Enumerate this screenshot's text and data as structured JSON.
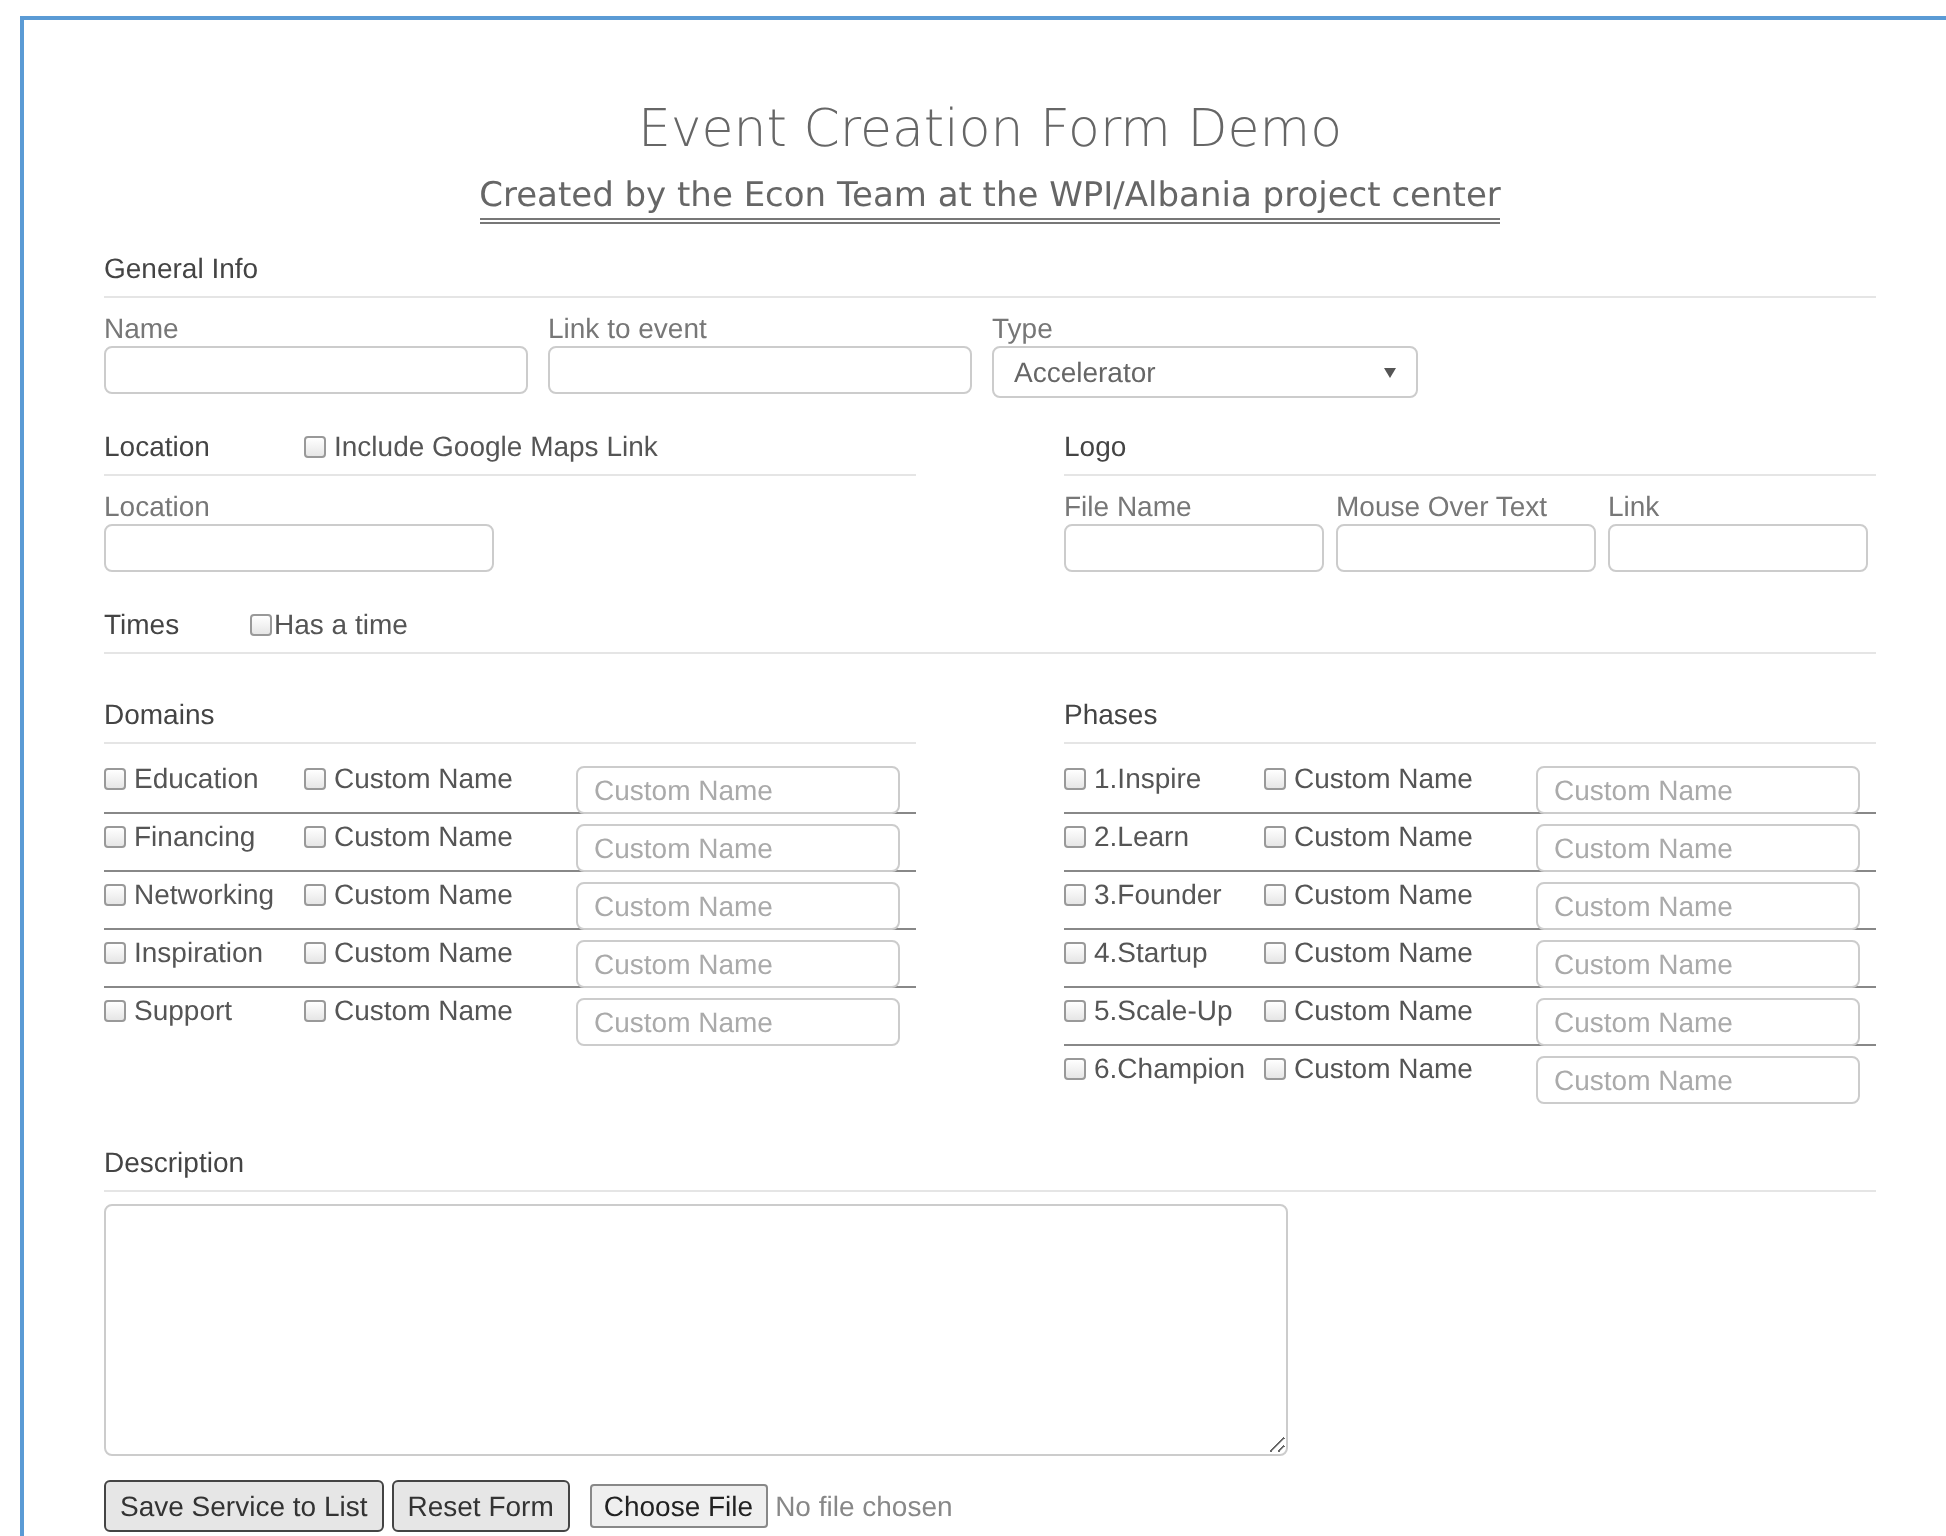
{
  "title": "Event Creation Form Demo",
  "subtitle": "Created by the Econ Team at the WPI/Albania project center",
  "general_info": {
    "heading": "General Info",
    "fields": [
      {
        "label": "Name",
        "kind": "text"
      },
      {
        "label": "Link to event",
        "kind": "text"
      },
      {
        "label": "Type",
        "kind": "select",
        "value": "Accelerator"
      }
    ]
  },
  "location": {
    "heading": "Location",
    "checkbox": {
      "label": "Include Google Maps Link",
      "checked": false
    },
    "field_label": "Location"
  },
  "logo": {
    "heading": "Logo",
    "fields": [
      "File Name",
      "Mouse Over Text",
      "Link"
    ]
  },
  "times": {
    "heading": "Times",
    "checkbox": {
      "label": "Has a time",
      "checked": false
    }
  },
  "domains": {
    "heading": "Domains",
    "rows": [
      {
        "label": "Education",
        "checked": false,
        "custom_label": "Custom Name",
        "custom_checked": false,
        "placeholder": "Custom Name"
      },
      {
        "label": "Financing",
        "checked": false,
        "custom_label": "Custom Name",
        "custom_checked": false,
        "placeholder": "Custom Name"
      },
      {
        "label": "Networking",
        "checked": false,
        "custom_label": "Custom Name",
        "custom_checked": false,
        "placeholder": "Custom Name"
      },
      {
        "label": "Inspiration",
        "checked": false,
        "custom_label": "Custom Name",
        "custom_checked": false,
        "placeholder": "Custom Name"
      },
      {
        "label": "Support",
        "checked": false,
        "custom_label": "Custom Name",
        "custom_checked": false,
        "placeholder": "Custom Name"
      }
    ]
  },
  "phases": {
    "heading": "Phases",
    "rows": [
      {
        "label": "1.Inspire",
        "checked": false,
        "custom_label": "Custom Name",
        "custom_checked": false,
        "placeholder": "Custom Name"
      },
      {
        "label": "2.Learn",
        "checked": false,
        "custom_label": "Custom Name",
        "custom_checked": false,
        "placeholder": "Custom Name"
      },
      {
        "label": "3.Founder",
        "checked": false,
        "custom_label": "Custom Name",
        "custom_checked": false,
        "placeholder": "Custom Name"
      },
      {
        "label": "4.Startup",
        "checked": false,
        "custom_label": "Custom Name",
        "custom_checked": false,
        "placeholder": "Custom Name"
      },
      {
        "label": "5.Scale-Up",
        "checked": false,
        "custom_label": "Custom Name",
        "custom_checked": false,
        "placeholder": "Custom Name"
      },
      {
        "label": "6.Champion",
        "checked": false,
        "custom_label": "Custom Name",
        "custom_checked": false,
        "placeholder": "Custom Name"
      }
    ]
  },
  "description": {
    "heading": "Description"
  },
  "buttons": [
    "Save Service to List",
    "Reset Form"
  ],
  "file_input": {
    "button": "Choose File",
    "status": "No file chosen"
  }
}
